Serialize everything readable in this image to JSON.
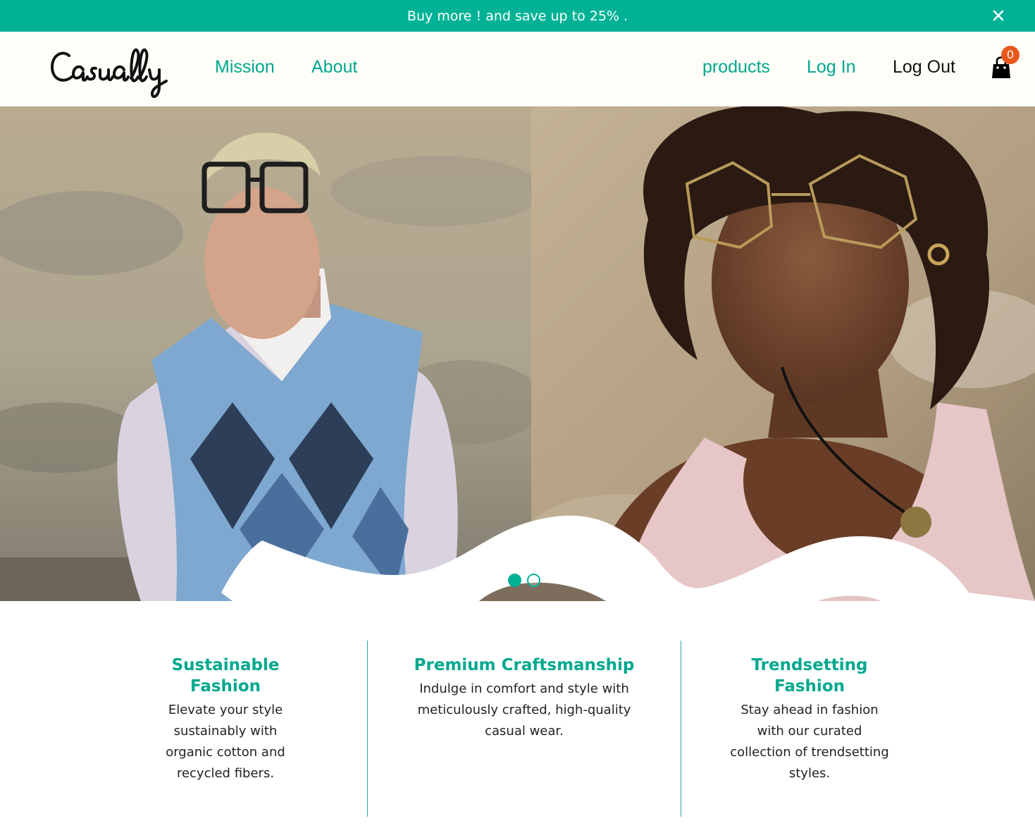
{
  "promo": {
    "text": "Buy more ! and save up to 25% .",
    "close_icon": "close-icon"
  },
  "header": {
    "logo_text": "Casually",
    "nav_left": [
      {
        "label": "Mission"
      },
      {
        "label": "About"
      }
    ],
    "nav_right": [
      {
        "label": "products"
      },
      {
        "label": "Log In"
      },
      {
        "label": "Log Out"
      }
    ],
    "cart": {
      "icon": "shopping-bag-icon",
      "count": "0"
    }
  },
  "hero": {
    "slides_total": 2,
    "active_slide": 1
  },
  "features": [
    {
      "title": "Sustainable Fashion",
      "text": "Elevate your style sustainably with organic cotton and recycled fibers."
    },
    {
      "title": "Premium Craftsmanship",
      "text": "Indulge in comfort and style with meticulously crafted, high-quality casual wear."
    },
    {
      "title": "Trendsetting Fashion",
      "text": "Stay ahead in fashion with our curated collection of trendsetting styles."
    }
  ],
  "colors": {
    "accent": "#00b295",
    "badge": "#e8571a",
    "header_bg": "#fffdf7"
  }
}
